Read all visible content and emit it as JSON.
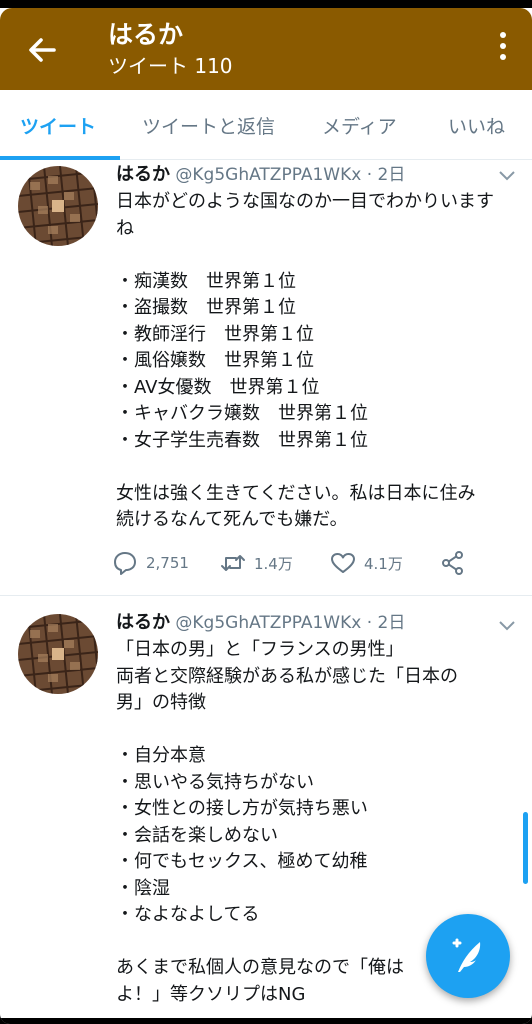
{
  "header": {
    "title": "はるか",
    "subtitle": "ツイート 110",
    "back_icon": "arrow-left-icon",
    "menu_icon": "more-vertical-icon",
    "color": "#8a5a00"
  },
  "tabs": [
    {
      "label": "ツイート",
      "active": true
    },
    {
      "label": "ツイートと返信",
      "active": false
    },
    {
      "label": "メディア",
      "active": false
    },
    {
      "label": "いいね",
      "active": false
    }
  ],
  "accent_color": "#1da1f2",
  "tweets": [
    {
      "name": "はるか",
      "handle": "@Kg5GhATZPPA1WKx",
      "dot": "·",
      "time": "2日",
      "lines": [
        "日本がどのような国なのか一目でわかりいます",
        "ね",
        "",
        "・痴漢数　世界第１位",
        "・盗撮数　世界第１位",
        "・教師淫行　世界第１位",
        "・風俗嬢数　世界第１位",
        "・AV女優数　世界第１位",
        "・キャバクラ嬢数　世界第１位",
        "・女子学生売春数　世界第１位",
        "",
        "女性は強く生きてください。私は日本に住み",
        "続けるなんて死んでも嫌だ。"
      ],
      "replies": "2,751",
      "retweets": "1.4万",
      "likes": "4.1万"
    },
    {
      "name": "はるか",
      "handle": "@Kg5GhATZPPA1WKx",
      "dot": "·",
      "time": "2日",
      "lines": [
        "「日本の男」と「フランスの男性」",
        "両者と交際経験がある私が感じた「日本の",
        "男」の特徴",
        "",
        "・自分本意",
        "・思いやる気持ちがない",
        "・女性との接し方が気持ち悪い",
        "・会話を楽しめない",
        "・何でもセックス、極めて幼稚",
        "・陰湿",
        "・なよなよしてる",
        "",
        "あくまで私個人の意見なので「俺は",
        "よ！」等クソリプはNG"
      ]
    }
  ],
  "fab_icon": "compose-feather-icon"
}
